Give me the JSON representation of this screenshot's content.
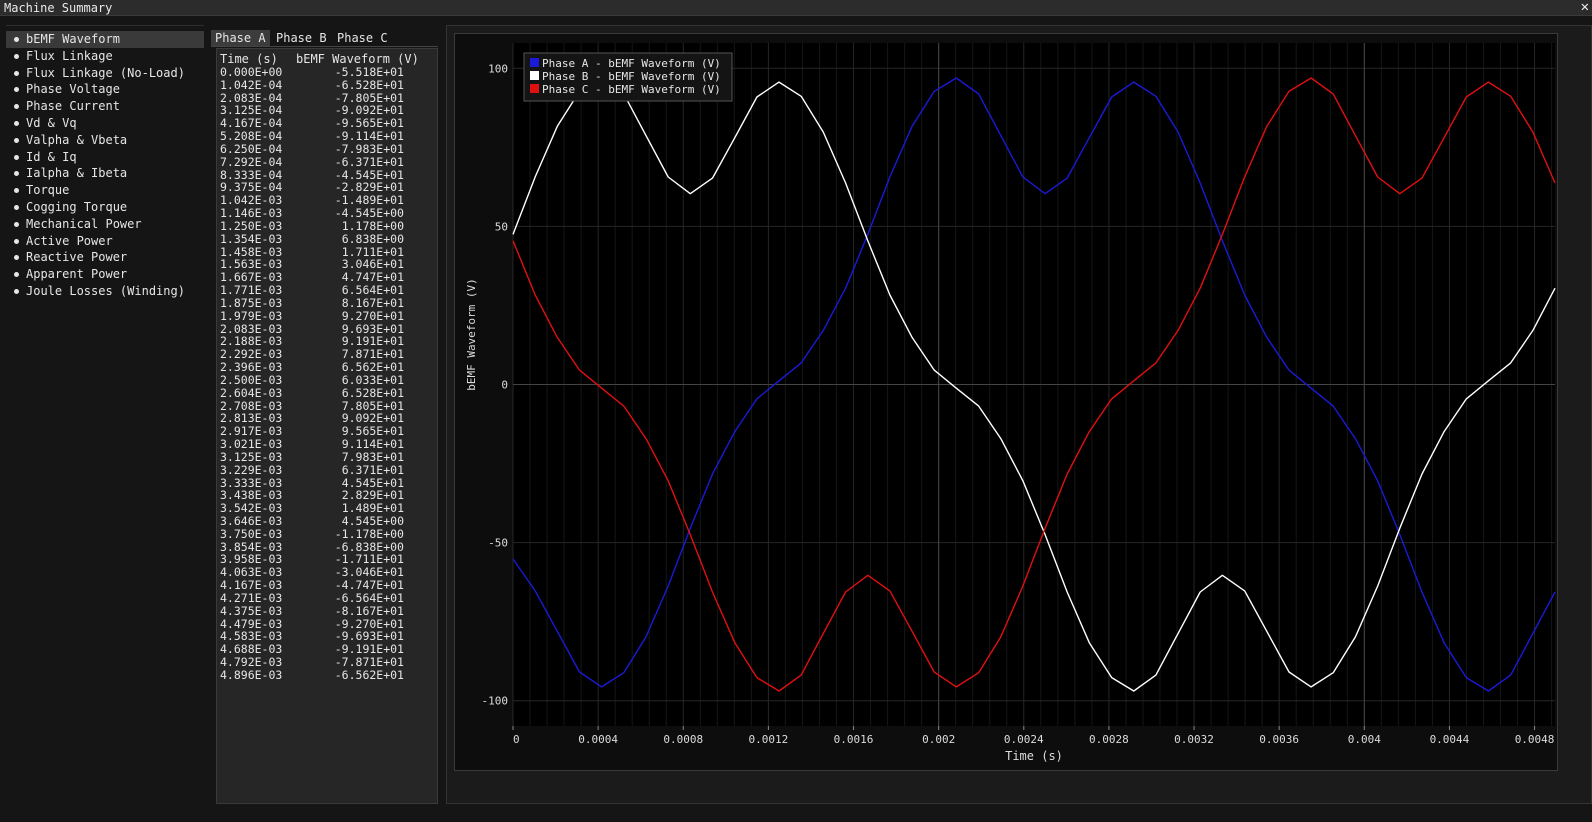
{
  "window": {
    "title": "Machine Summary",
    "close_glyph": "✕"
  },
  "sidebar": {
    "items": [
      {
        "label": "bEMF Waveform",
        "active": true
      },
      {
        "label": "Flux Linkage"
      },
      {
        "label": "Flux Linkage (No-Load)"
      },
      {
        "label": "Phase Voltage"
      },
      {
        "label": "Phase Current"
      },
      {
        "label": "Vd & Vq"
      },
      {
        "label": "Valpha & Vbeta"
      },
      {
        "label": "Id & Iq"
      },
      {
        "label": "Ialpha & Ibeta"
      },
      {
        "label": "Torque"
      },
      {
        "label": "Cogging Torque"
      },
      {
        "label": "Mechanical Power"
      },
      {
        "label": "Active Power"
      },
      {
        "label": "Reactive Power"
      },
      {
        "label": "Apparent Power"
      },
      {
        "label": "Joule Losses (Winding)"
      }
    ]
  },
  "tabs": [
    {
      "label": "Phase A",
      "active": true
    },
    {
      "label": "Phase B"
    },
    {
      "label": "Phase C"
    }
  ],
  "table": {
    "columns": [
      "Time (s)",
      "bEMF Waveform (V)"
    ],
    "rows": [
      [
        "0.000E+00",
        "-5.518E+01"
      ],
      [
        "1.042E-04",
        "-6.528E+01"
      ],
      [
        "2.083E-04",
        "-7.805E+01"
      ],
      [
        "3.125E-04",
        "-9.092E+01"
      ],
      [
        "4.167E-04",
        "-9.565E+01"
      ],
      [
        "5.208E-04",
        "-9.114E+01"
      ],
      [
        "6.250E-04",
        "-7.983E+01"
      ],
      [
        "7.292E-04",
        "-6.371E+01"
      ],
      [
        "8.333E-04",
        "-4.545E+01"
      ],
      [
        "9.375E-04",
        "-2.829E+01"
      ],
      [
        "1.042E-03",
        "-1.489E+01"
      ],
      [
        "1.146E-03",
        "-4.545E+00"
      ],
      [
        "1.250E-03",
        "1.178E+00"
      ],
      [
        "1.354E-03",
        "6.838E+00"
      ],
      [
        "1.458E-03",
        "1.711E+01"
      ],
      [
        "1.563E-03",
        "3.046E+01"
      ],
      [
        "1.667E-03",
        "4.747E+01"
      ],
      [
        "1.771E-03",
        "6.564E+01"
      ],
      [
        "1.875E-03",
        "8.167E+01"
      ],
      [
        "1.979E-03",
        "9.270E+01"
      ],
      [
        "2.083E-03",
        "9.693E+01"
      ],
      [
        "2.188E-03",
        "9.191E+01"
      ],
      [
        "2.292E-03",
        "7.871E+01"
      ],
      [
        "2.396E-03",
        "6.562E+01"
      ],
      [
        "2.500E-03",
        "6.033E+01"
      ],
      [
        "2.604E-03",
        "6.528E+01"
      ],
      [
        "2.708E-03",
        "7.805E+01"
      ],
      [
        "2.813E-03",
        "9.092E+01"
      ],
      [
        "2.917E-03",
        "9.565E+01"
      ],
      [
        "3.021E-03",
        "9.114E+01"
      ],
      [
        "3.125E-03",
        "7.983E+01"
      ],
      [
        "3.229E-03",
        "6.371E+01"
      ],
      [
        "3.333E-03",
        "4.545E+01"
      ],
      [
        "3.438E-03",
        "2.829E+01"
      ],
      [
        "3.542E-03",
        "1.489E+01"
      ],
      [
        "3.646E-03",
        "4.545E+00"
      ],
      [
        "3.750E-03",
        "-1.178E+00"
      ],
      [
        "3.854E-03",
        "-6.838E+00"
      ],
      [
        "3.958E-03",
        "-1.711E+01"
      ],
      [
        "4.063E-03",
        "-3.046E+01"
      ],
      [
        "4.167E-03",
        "-4.747E+01"
      ],
      [
        "4.271E-03",
        "-6.564E+01"
      ],
      [
        "4.375E-03",
        "-8.167E+01"
      ],
      [
        "4.479E-03",
        "-9.270E+01"
      ],
      [
        "4.583E-03",
        "-9.693E+01"
      ],
      [
        "4.688E-03",
        "-9.191E+01"
      ],
      [
        "4.792E-03",
        "-7.871E+01"
      ],
      [
        "4.896E-03",
        "-6.562E+01"
      ]
    ]
  },
  "chart_data": {
    "type": "line",
    "xlabel": "Time (s)",
    "ylabel": "bEMF Waveform (V)",
    "xlim": [
      0,
      0.004896
    ],
    "ylim": [
      -108,
      108
    ],
    "x_ticks": [
      "0",
      "0.0004",
      "0.0008",
      "0.0012",
      "0.0016",
      "0.002",
      "0.0024",
      "0.0028",
      "0.0032",
      "0.0036",
      "0.004",
      "0.0044",
      "0.0048"
    ],
    "y_ticks": [
      "100",
      "50",
      "0",
      "-50",
      "-100"
    ],
    "grid": true,
    "legend_position": "top-left",
    "x": [
      0,
      0.0001042,
      0.0002083,
      0.0003125,
      0.0004167,
      0.0005208,
      0.000625,
      0.0007292,
      0.0008333,
      0.0009375,
      0.001042,
      0.001146,
      0.00125,
      0.001354,
      0.001458,
      0.001563,
      0.001667,
      0.001771,
      0.001875,
      0.001979,
      0.002083,
      0.002188,
      0.002292,
      0.002396,
      0.0025,
      0.002604,
      0.002708,
      0.002813,
      0.002917,
      0.003021,
      0.003125,
      0.003229,
      0.003333,
      0.003438,
      0.003542,
      0.003646,
      0.00375,
      0.003854,
      0.003958,
      0.004063,
      0.004167,
      0.004271,
      0.004375,
      0.004479,
      0.004583,
      0.004688,
      0.004792,
      0.004896
    ],
    "series": [
      {
        "name": "Phase A - bEMF Waveform (V)",
        "color": "#1a1ad8",
        "values": [
          -55.18,
          -65.28,
          -78.05,
          -90.92,
          -95.65,
          -91.14,
          -79.83,
          -63.71,
          -45.45,
          -28.29,
          -14.89,
          -4.545,
          1.178,
          6.838,
          17.11,
          30.46,
          47.47,
          65.64,
          81.67,
          92.7,
          96.93,
          91.91,
          78.71,
          65.62,
          60.33,
          65.28,
          78.05,
          90.92,
          95.65,
          91.14,
          79.83,
          63.71,
          45.45,
          28.29,
          14.89,
          4.545,
          -1.178,
          -6.838,
          -17.11,
          -30.46,
          -47.47,
          -65.64,
          -81.67,
          -92.7,
          -96.93,
          -91.91,
          -78.71,
          -65.62
        ]
      },
      {
        "name": "Phase B - bEMF Waveform (V)",
        "color": "#ffffff",
        "values": [
          47.47,
          65.64,
          81.67,
          92.7,
          96.93,
          91.91,
          78.71,
          65.62,
          60.33,
          65.28,
          78.05,
          90.92,
          95.65,
          91.14,
          79.83,
          63.71,
          45.45,
          28.29,
          14.89,
          4.545,
          -1.178,
          -6.838,
          -17.11,
          -30.46,
          -47.47,
          -65.64,
          -81.67,
          -92.7,
          -96.93,
          -91.91,
          -78.71,
          -65.62,
          -60.33,
          -65.28,
          -78.05,
          -90.92,
          -95.65,
          -91.14,
          -79.83,
          -63.71,
          -45.45,
          -28.29,
          -14.89,
          -4.545,
          1.178,
          6.838,
          17.11,
          30.46
        ]
      },
      {
        "name": "Phase C - bEMF Waveform (V)",
        "color": "#e01010",
        "values": [
          45.45,
          28.29,
          14.89,
          4.545,
          -1.178,
          -6.838,
          -17.11,
          -30.46,
          -47.47,
          -65.64,
          -81.67,
          -92.7,
          -96.93,
          -91.91,
          -78.71,
          -65.62,
          -60.33,
          -65.28,
          -78.05,
          -90.92,
          -95.65,
          -91.14,
          -79.83,
          -63.71,
          -45.45,
          -28.29,
          -14.89,
          -4.545,
          1.178,
          6.838,
          17.11,
          30.46,
          47.47,
          65.64,
          81.67,
          92.7,
          96.93,
          91.91,
          78.71,
          65.62,
          60.33,
          65.28,
          78.05,
          90.92,
          95.65,
          91.14,
          79.83,
          63.71
        ]
      }
    ]
  }
}
